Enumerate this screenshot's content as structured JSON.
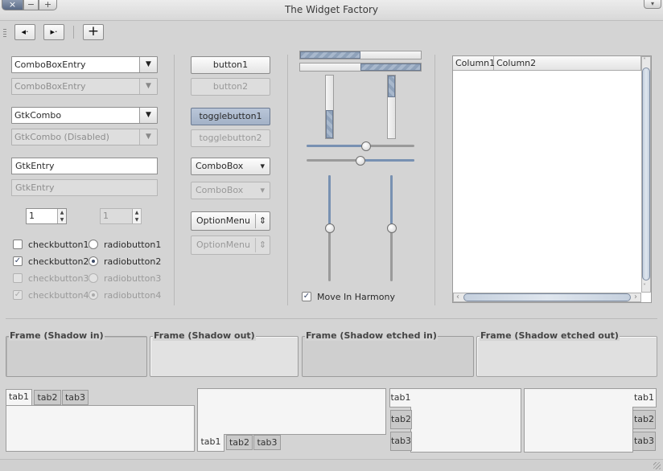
{
  "window": {
    "title": "The Widget Factory",
    "close_icon": "×",
    "minimize_icon": "−",
    "maximize_icon": "+",
    "menu_icon": "▾"
  },
  "toolbar": {
    "prev_icon": "◂·",
    "next_icon": "▸·",
    "add_icon": "+"
  },
  "combos": {
    "combo_entry": "ComboBoxEntry",
    "combo_entry_disabled": "ComboBoxEntry",
    "gtk_combo": "GtkCombo",
    "gtk_combo_disabled": "GtkCombo (Disabled)",
    "arrow": "▼"
  },
  "entries": {
    "entry": "GtkEntry",
    "entry_disabled": "GtkEntry"
  },
  "spins": {
    "spin": "1",
    "spin_disabled": "1",
    "arrows_up": "▲",
    "arrows_down": "▼"
  },
  "checks": [
    {
      "label": "checkbutton1",
      "checked": false,
      "disabled": false
    },
    {
      "label": "checkbutton2",
      "checked": true,
      "disabled": false
    },
    {
      "label": "checkbutton3",
      "checked": false,
      "disabled": true
    },
    {
      "label": "checkbutton4",
      "checked": true,
      "disabled": true
    }
  ],
  "radios": [
    {
      "label": "radiobutton1",
      "selected": false,
      "disabled": false
    },
    {
      "label": "radiobutton2",
      "selected": true,
      "disabled": false
    },
    {
      "label": "radiobutton3",
      "selected": false,
      "disabled": true
    },
    {
      "label": "radiobutton4",
      "selected": true,
      "disabled": true
    }
  ],
  "check_mark": "✓",
  "buttons": {
    "button1": "button1",
    "button2": "button2",
    "toggle1": "togglebutton1",
    "toggle2": "togglebutton2",
    "combobox": "ComboBox",
    "combobox_disabled": "ComboBox",
    "optionmenu": "OptionMenu",
    "optionmenu_disabled": "OptionMenu",
    "down_arrow": "▾",
    "updown_arrow": "⇕"
  },
  "progress": {
    "h1": 0.5,
    "h2": 0.5,
    "v1": 0.45,
    "v2": 0.35
  },
  "sliders": {
    "h1": 0.55,
    "h2": 0.5,
    "v1": 0.5,
    "v2": 0.5
  },
  "harmony": {
    "label": "Move In Harmony",
    "checked": true
  },
  "treeview": {
    "columns": [
      "Column1",
      "Column2"
    ],
    "rows": [],
    "scroll_left": "‹",
    "scroll_right": "›",
    "scroll_up": "˄",
    "scroll_down": "˅"
  },
  "frames": [
    {
      "label": "Frame (Shadow in)"
    },
    {
      "label": "Frame (Shadow out)"
    },
    {
      "label": "Frame (Shadow etched in)"
    },
    {
      "label": "Frame (Shadow etched out)"
    }
  ],
  "notebooks": {
    "tabs": [
      "tab1",
      "tab2",
      "tab3"
    ]
  },
  "colors": {
    "accent": "#7891b2",
    "toggle_active": "#a3b2c7",
    "background": "#d4d4d4"
  }
}
